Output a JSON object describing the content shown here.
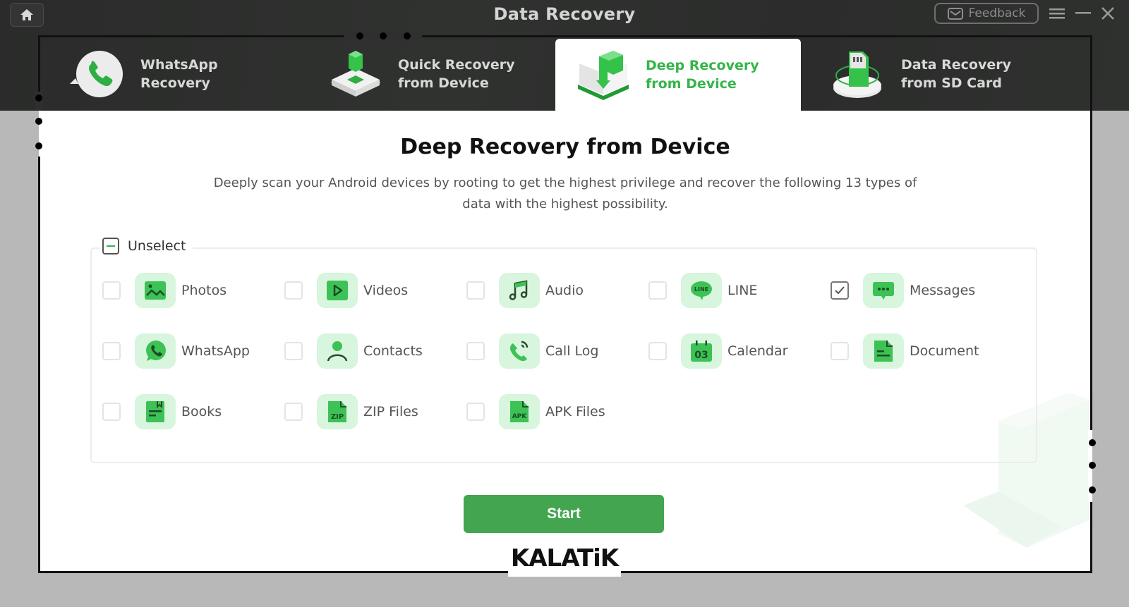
{
  "window": {
    "title": "Data Recovery",
    "feedback_label": "Feedback",
    "icons": {
      "home": "home-icon",
      "feedback": "mail-icon",
      "menu": "hamburger-menu-icon",
      "minimize": "minimize-icon",
      "close": "close-icon"
    }
  },
  "tabs": [
    {
      "line1": "WhatsApp",
      "line2": "Recovery",
      "icon": "whatsapp-phone-icon",
      "active": false
    },
    {
      "line1": "Quick Recovery",
      "line2": "from Device",
      "icon": "quick-recovery-cube-icon",
      "active": false
    },
    {
      "line1": "Deep Recovery",
      "line2": "from Device",
      "icon": "deep-recovery-download-icon",
      "active": true
    },
    {
      "line1": "Data Recovery",
      "line2": "from SD Card",
      "icon": "sd-card-icon",
      "active": false
    }
  ],
  "main": {
    "title": "Deep Recovery from Device",
    "description": "Deeply scan your Android devices by rooting to get the highest privilege and recover the following 13 types of data with the highest possibility.",
    "unselect_label": "Unselect",
    "items": [
      {
        "label": "Photos",
        "icon": "photo-icon",
        "checked": false
      },
      {
        "label": "Videos",
        "icon": "video-play-icon",
        "checked": false
      },
      {
        "label": "Audio",
        "icon": "music-note-icon",
        "checked": false
      },
      {
        "label": "LINE",
        "icon": "line-app-icon",
        "checked": false
      },
      {
        "label": "Messages",
        "icon": "message-bubble-icon",
        "checked": true
      },
      {
        "label": "WhatsApp",
        "icon": "whatsapp-icon",
        "checked": false
      },
      {
        "label": "Contacts",
        "icon": "contact-person-icon",
        "checked": false
      },
      {
        "label": "Call Log",
        "icon": "call-log-icon",
        "checked": false
      },
      {
        "label": "Calendar",
        "icon": "calendar-icon",
        "checked": false
      },
      {
        "label": "Document",
        "icon": "document-icon",
        "checked": false
      },
      {
        "label": "Books",
        "icon": "book-icon",
        "checked": false
      },
      {
        "label": "ZIP Files",
        "icon": "zip-file-icon",
        "checked": false
      },
      {
        "label": "APK Files",
        "icon": "apk-file-icon",
        "checked": false
      }
    ],
    "calendar_day": "03",
    "start_label": "Start"
  },
  "watermark_brand": "KALATiK",
  "colors": {
    "accent_green": "#35b54a",
    "start_button": "#43a54f",
    "icon_bg": "#d8f5de",
    "titlebar": "#2e2f2e"
  }
}
